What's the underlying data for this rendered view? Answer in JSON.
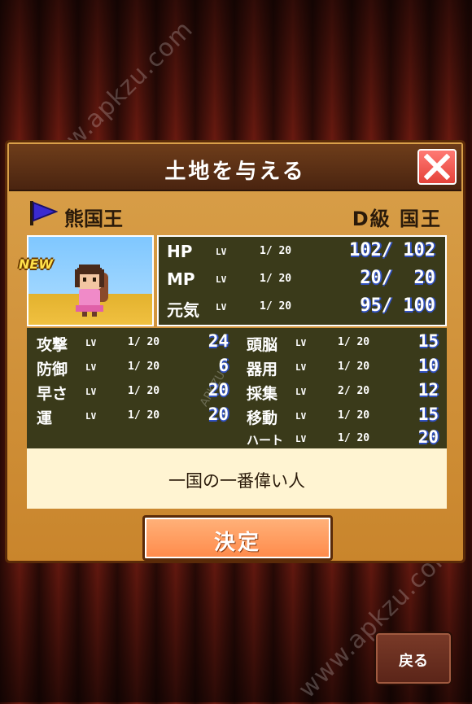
{
  "watermark": "www.apkzu.com",
  "dialog": {
    "title": "土地を与える",
    "character": {
      "name": "熊国王",
      "rank": "D級 国王",
      "badge": "NEW"
    },
    "main_stats": [
      {
        "label": "HP",
        "lv_tag": "LV",
        "level": "1/ 20",
        "value": "102/ 102"
      },
      {
        "label": "MP",
        "lv_tag": "LV",
        "level": "1/ 20",
        "value": "20/  20"
      },
      {
        "label": "元気",
        "lv_tag": "LV",
        "level": "1/ 20",
        "value": "95/ 100"
      }
    ],
    "sub_stats_left": [
      {
        "label": "攻撃",
        "lv_tag": "LV",
        "level": "1/ 20",
        "value": "24"
      },
      {
        "label": "防御",
        "lv_tag": "LV",
        "level": "1/ 20",
        "value": "6"
      },
      {
        "label": "早さ",
        "lv_tag": "LV",
        "level": "1/ 20",
        "value": "20"
      },
      {
        "label": "運",
        "lv_tag": "LV",
        "level": "1/ 20",
        "value": "20"
      }
    ],
    "sub_stats_right": [
      {
        "label": "頭脳",
        "lv_tag": "LV",
        "level": "1/ 20",
        "value": "15"
      },
      {
        "label": "器用",
        "lv_tag": "LV",
        "level": "1/ 20",
        "value": "10"
      },
      {
        "label": "採集",
        "lv_tag": "LV",
        "level": "2/ 20",
        "value": "12"
      },
      {
        "label": "移動",
        "lv_tag": "LV",
        "level": "1/ 20",
        "value": "15"
      },
      {
        "label": "ハート",
        "lv_tag": "LV",
        "level": "1/ 20",
        "value": "20"
      }
    ],
    "description": "一国の一番偉い人",
    "confirm_label": "決定"
  },
  "back_label": "戻る",
  "colors": {
    "stat_panel": "#3a3a1a",
    "dialog_bg": "#d9a04a",
    "confirm_button": "#ff8a4a",
    "close_button": "#e5433a",
    "flag": "#3a2ad0"
  },
  "icons": {
    "close": "close-x-icon",
    "flag": "flag-icon"
  }
}
